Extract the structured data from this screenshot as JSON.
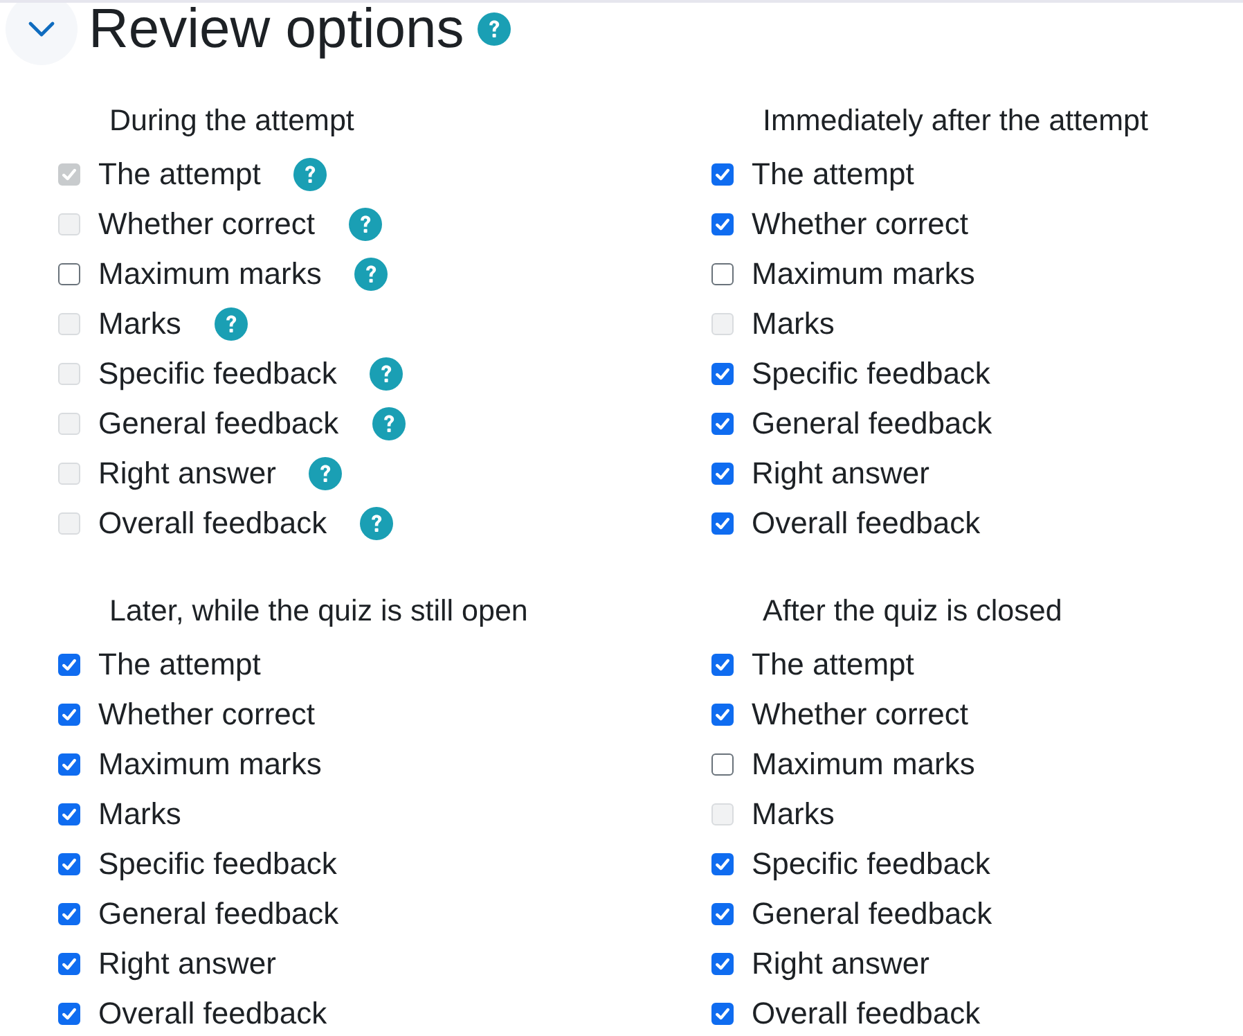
{
  "section": {
    "title": "Review options",
    "expanded": true,
    "help": true
  },
  "groups": [
    {
      "heading": "During the attempt",
      "options": [
        {
          "label": "The attempt",
          "checked": true,
          "disabled": true,
          "help": true
        },
        {
          "label": "Whether correct",
          "checked": false,
          "disabled": true,
          "help": true
        },
        {
          "label": "Maximum marks",
          "checked": false,
          "disabled": false,
          "help": true
        },
        {
          "label": "Marks",
          "checked": false,
          "disabled": true,
          "help": true
        },
        {
          "label": "Specific feedback",
          "checked": false,
          "disabled": true,
          "help": true
        },
        {
          "label": "General feedback",
          "checked": false,
          "disabled": true,
          "help": true
        },
        {
          "label": "Right answer",
          "checked": false,
          "disabled": true,
          "help": true
        },
        {
          "label": "Overall feedback",
          "checked": false,
          "disabled": true,
          "help": true
        }
      ]
    },
    {
      "heading": "Immediately after the attempt",
      "options": [
        {
          "label": "The attempt",
          "checked": true,
          "disabled": false,
          "help": false
        },
        {
          "label": "Whether correct",
          "checked": true,
          "disabled": false,
          "help": false
        },
        {
          "label": "Maximum marks",
          "checked": false,
          "disabled": false,
          "help": false
        },
        {
          "label": "Marks",
          "checked": false,
          "disabled": true,
          "help": false
        },
        {
          "label": "Specific feedback",
          "checked": true,
          "disabled": false,
          "help": false
        },
        {
          "label": "General feedback",
          "checked": true,
          "disabled": false,
          "help": false
        },
        {
          "label": "Right answer",
          "checked": true,
          "disabled": false,
          "help": false
        },
        {
          "label": "Overall feedback",
          "checked": true,
          "disabled": false,
          "help": false
        }
      ]
    },
    {
      "heading": "Later, while the quiz is still open",
      "options": [
        {
          "label": "The attempt",
          "checked": true,
          "disabled": false,
          "help": false
        },
        {
          "label": "Whether correct",
          "checked": true,
          "disabled": false,
          "help": false
        },
        {
          "label": "Maximum marks",
          "checked": true,
          "disabled": false,
          "help": false
        },
        {
          "label": "Marks",
          "checked": true,
          "disabled": false,
          "help": false
        },
        {
          "label": "Specific feedback",
          "checked": true,
          "disabled": false,
          "help": false
        },
        {
          "label": "General feedback",
          "checked": true,
          "disabled": false,
          "help": false
        },
        {
          "label": "Right answer",
          "checked": true,
          "disabled": false,
          "help": false
        },
        {
          "label": "Overall feedback",
          "checked": true,
          "disabled": false,
          "help": false
        }
      ]
    },
    {
      "heading": "After the quiz is closed",
      "options": [
        {
          "label": "The attempt",
          "checked": true,
          "disabled": false,
          "help": false
        },
        {
          "label": "Whether correct",
          "checked": true,
          "disabled": false,
          "help": false
        },
        {
          "label": "Maximum marks",
          "checked": false,
          "disabled": false,
          "help": false
        },
        {
          "label": "Marks",
          "checked": false,
          "disabled": true,
          "help": false
        },
        {
          "label": "Specific feedback",
          "checked": true,
          "disabled": false,
          "help": false
        },
        {
          "label": "General feedback",
          "checked": true,
          "disabled": false,
          "help": false
        },
        {
          "label": "Right answer",
          "checked": true,
          "disabled": false,
          "help": false
        },
        {
          "label": "Overall feedback",
          "checked": true,
          "disabled": false,
          "help": false
        }
      ]
    }
  ]
}
